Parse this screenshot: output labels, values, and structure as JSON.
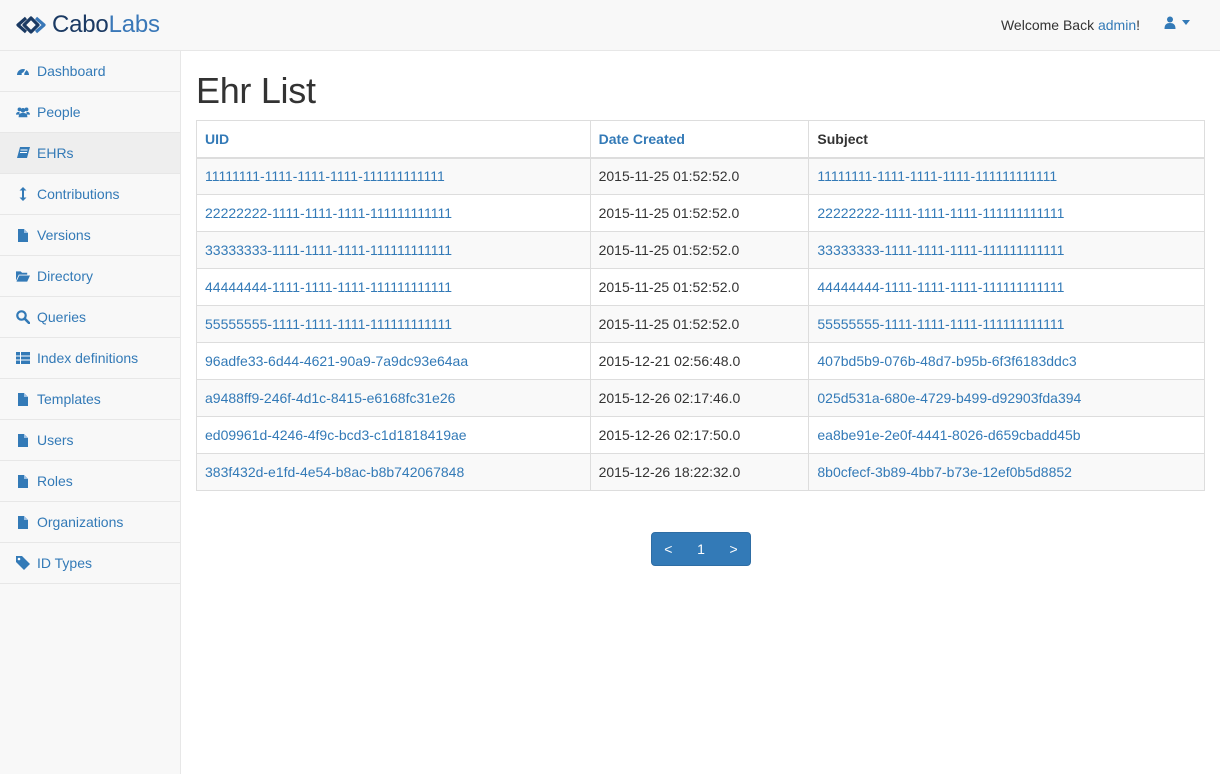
{
  "brand": {
    "part1": "Cabo",
    "part2": "Labs"
  },
  "header": {
    "welcome_prefix": "Welcome Back ",
    "username": "admin",
    "welcome_suffix": "!"
  },
  "sidebar": {
    "items": [
      {
        "label": "Dashboard",
        "icon": "dashboard-icon"
      },
      {
        "label": "People",
        "icon": "users-icon"
      },
      {
        "label": "EHRs",
        "icon": "book-icon"
      },
      {
        "label": "Contributions",
        "icon": "arrows-v-icon"
      },
      {
        "label": "Versions",
        "icon": "file-icon"
      },
      {
        "label": "Directory",
        "icon": "folder-open-icon"
      },
      {
        "label": "Queries",
        "icon": "search-icon"
      },
      {
        "label": "Index definitions",
        "icon": "table-icon"
      },
      {
        "label": "Templates",
        "icon": "file-icon"
      },
      {
        "label": "Users",
        "icon": "file-icon"
      },
      {
        "label": "Roles",
        "icon": "file-icon"
      },
      {
        "label": "Organizations",
        "icon": "file-icon"
      },
      {
        "label": "ID Types",
        "icon": "tag-icon"
      }
    ],
    "active_index": 2
  },
  "main": {
    "title": "Ehr List",
    "columns": [
      "UID",
      "Date Created",
      "Subject"
    ],
    "rows": [
      {
        "uid": "11111111-1111-1111-1111-111111111111",
        "date": "2015-11-25 01:52:52.0",
        "subject": "11111111-1111-1111-1111-111111111111"
      },
      {
        "uid": "22222222-1111-1111-1111-111111111111",
        "date": "2015-11-25 01:52:52.0",
        "subject": "22222222-1111-1111-1111-111111111111"
      },
      {
        "uid": "33333333-1111-1111-1111-111111111111",
        "date": "2015-11-25 01:52:52.0",
        "subject": "33333333-1111-1111-1111-111111111111"
      },
      {
        "uid": "44444444-1111-1111-1111-111111111111",
        "date": "2015-11-25 01:52:52.0",
        "subject": "44444444-1111-1111-1111-111111111111"
      },
      {
        "uid": "55555555-1111-1111-1111-111111111111",
        "date": "2015-11-25 01:52:52.0",
        "subject": "55555555-1111-1111-1111-111111111111"
      },
      {
        "uid": "96adfe33-6d44-4621-90a9-7a9dc93e64aa",
        "date": "2015-12-21 02:56:48.0",
        "subject": "407bd5b9-076b-48d7-b95b-6f3f6183ddc3"
      },
      {
        "uid": "a9488ff9-246f-4d1c-8415-e6168fc31e26",
        "date": "2015-12-26 02:17:46.0",
        "subject": "025d531a-680e-4729-b499-d92903fda394"
      },
      {
        "uid": "ed09961d-4246-4f9c-bcd3-c1d1818419ae",
        "date": "2015-12-26 02:17:50.0",
        "subject": "ea8be91e-2e0f-4441-8026-d659cbadd45b"
      },
      {
        "uid": "383f432d-e1fd-4e54-b8ac-b8b742067848",
        "date": "2015-12-26 18:22:32.0",
        "subject": "8b0cfecf-3b89-4bb7-b73e-12ef0b5d8852"
      }
    ],
    "pagination": {
      "prev": "<",
      "page": "1",
      "next": ">"
    }
  },
  "colors": {
    "link": "#337ab7",
    "brand_dark": "#1b3a63",
    "brand_light": "#3a78b8"
  }
}
